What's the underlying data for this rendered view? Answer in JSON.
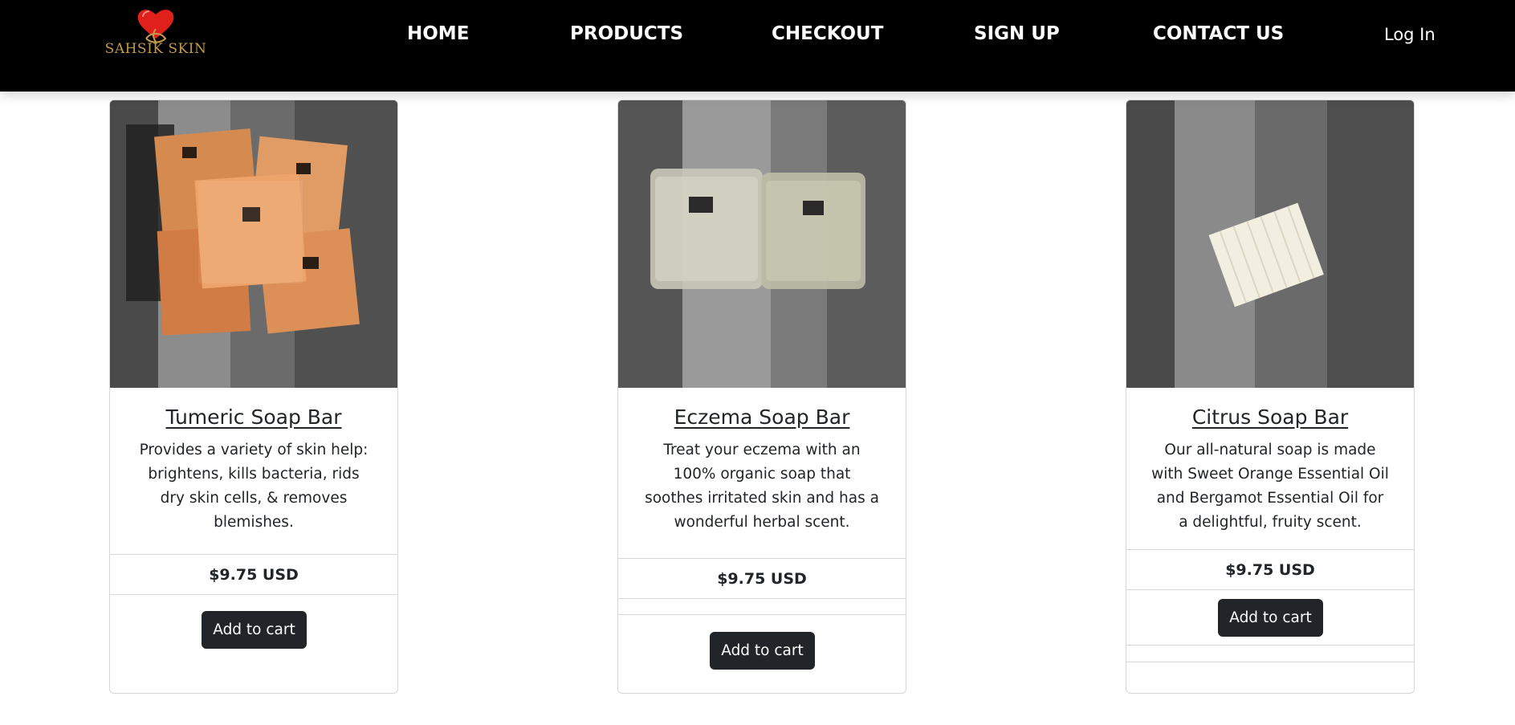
{
  "brand": {
    "name": "SAHSIK SKIN"
  },
  "nav": {
    "home": "HOME",
    "products": "PRODUCTS",
    "checkout": "CHECKOUT",
    "signup": "SIGN UP",
    "contact": "CONTACT US",
    "login": "Log In"
  },
  "products": [
    {
      "title": "Tumeric Soap Bar",
      "description": "Provides a variety of skin help: brightens, kills bacteria, rids dry skin cells, & removes blemishes.",
      "price": "$9.75 USD",
      "button": "Add to cart"
    },
    {
      "title": "Eczema Soap Bar",
      "description": "Treat your eczema with an 100% organic soap that soothes irritated skin and has a wonderful herbal scent.",
      "price": "$9.75 USD",
      "button": "Add to cart"
    },
    {
      "title": "Citrus Soap Bar",
      "description": "Our all-natural soap is made with Sweet Orange Essential Oil and Bergamot Essential Oil for a delightful, fruity scent.",
      "price": "$9.75 USD",
      "button": "Add to cart"
    }
  ],
  "colors": {
    "navbar": "#000000",
    "button": "#212529",
    "brand_gold": "#c29a4a",
    "heart_red": "#e0201b"
  }
}
